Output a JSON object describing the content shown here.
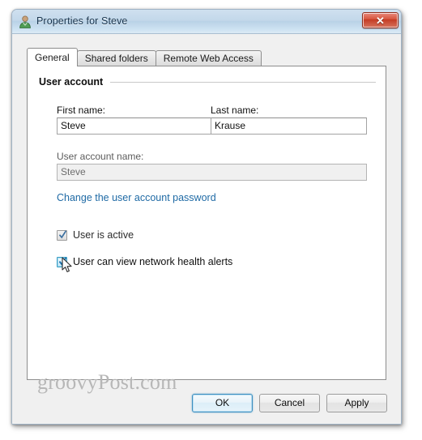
{
  "window": {
    "title": "Properties for Steve",
    "icon": "user-account-icon",
    "close_label": "✕",
    "close_tooltip": "Close"
  },
  "tabs": [
    {
      "label": "General",
      "active": true
    },
    {
      "label": "Shared folders",
      "active": false
    },
    {
      "label": "Remote Web Access",
      "active": false
    }
  ],
  "general": {
    "group_title": "User account",
    "fields": {
      "first_name": {
        "label": "First name:",
        "value": "Steve",
        "placeholder": ""
      },
      "last_name": {
        "label": "Last name:",
        "value": "Krause",
        "placeholder": ""
      },
      "account_name": {
        "label": "User account name:",
        "value": "Steve",
        "placeholder": "",
        "readonly": true
      }
    },
    "password_link": "Change the user account password",
    "checkboxes": [
      {
        "label": "User is active",
        "checked": true,
        "hovered": false
      },
      {
        "label": "User can view network health alerts",
        "checked": true,
        "hovered": true
      }
    ]
  },
  "buttons": {
    "ok": "OK",
    "cancel": "Cancel",
    "apply": "Apply"
  },
  "watermark": "groovyPost.com",
  "colors": {
    "titlebar_text": "#16334d",
    "link": "#1f6aa5",
    "close_button": "#c43c24",
    "default_button_border": "#3d8fc0",
    "checkbox_hover_border": "#3d9ec4",
    "watermark": "#b7b7b7"
  }
}
